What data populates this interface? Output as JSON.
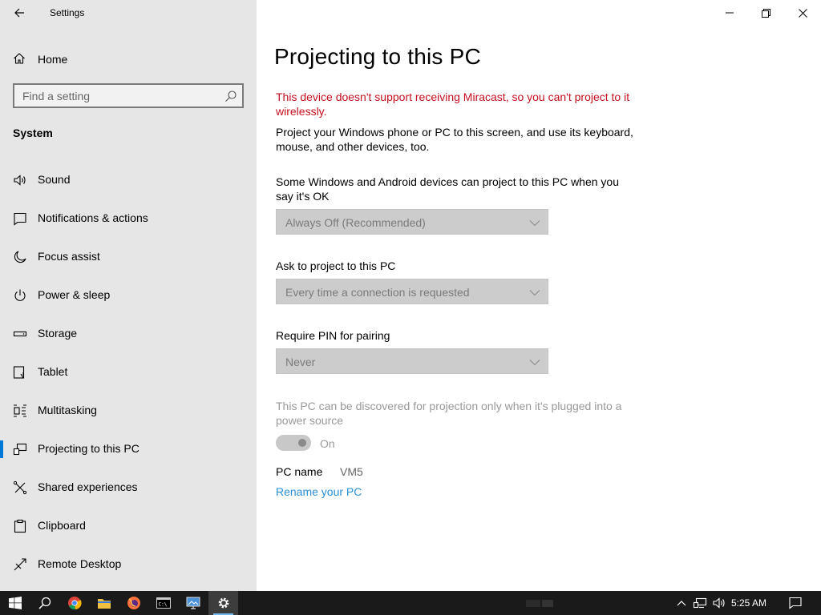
{
  "window": {
    "app_title": "Settings"
  },
  "sidebar": {
    "home_label": "Home",
    "search_placeholder": "Find a setting",
    "section_label": "System",
    "items": [
      {
        "label": "Sound",
        "icon": "speaker-icon"
      },
      {
        "label": "Notifications & actions",
        "icon": "notification-icon"
      },
      {
        "label": "Focus assist",
        "icon": "moon-icon"
      },
      {
        "label": "Power & sleep",
        "icon": "power-icon"
      },
      {
        "label": "Storage",
        "icon": "storage-icon"
      },
      {
        "label": "Tablet",
        "icon": "tablet-icon"
      },
      {
        "label": "Multitasking",
        "icon": "multitasking-icon"
      },
      {
        "label": "Projecting to this PC",
        "icon": "projecting-icon",
        "active": true
      },
      {
        "label": "Shared experiences",
        "icon": "shared-experiences-icon"
      },
      {
        "label": "Clipboard",
        "icon": "clipboard-icon"
      },
      {
        "label": "Remote Desktop",
        "icon": "remote-desktop-icon"
      }
    ]
  },
  "main": {
    "title": "Projecting to this PC",
    "error": "This device doesn't support receiving Miracast, so you can't project to it wirelessly.",
    "description": "Project your Windows phone or PC to this screen, and use its keyboard, mouse, and other devices, too.",
    "setting1_label": "Some Windows and Android devices can project to this PC when you say it's OK",
    "setting1_value": "Always Off (Recommended)",
    "setting2_label": "Ask to project to this PC",
    "setting2_value": "Every time a connection is requested",
    "setting3_label": "Require PIN for pairing",
    "setting3_value": "Never",
    "power_note": "This PC can be discovered for projection only when it's plugged into a power source",
    "toggle_state": "On",
    "pc_name_label": "PC name",
    "pc_name_value": "VM5",
    "rename_link": "Rename your PC"
  },
  "taskbar": {
    "time": "5:25 AM"
  },
  "colors": {
    "accent": "#0078d7",
    "error": "#c50f1f",
    "link": "#2a8fd6",
    "sidebar_bg": "#e6e6e6",
    "taskbar_bg": "#1a1a1a"
  }
}
